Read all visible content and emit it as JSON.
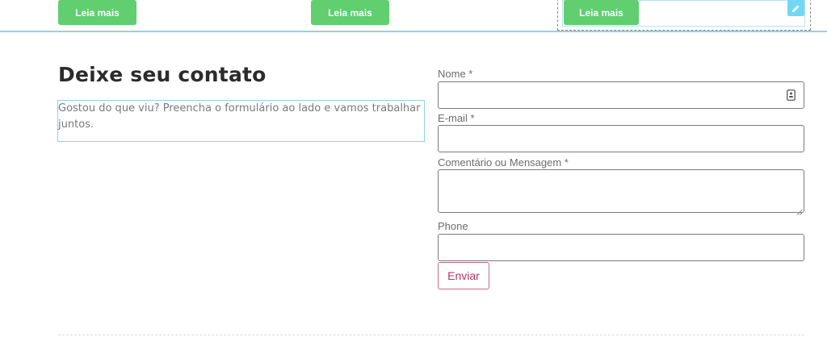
{
  "top_buttons": [
    {
      "label": "Leia mais"
    },
    {
      "label": "Leia mais"
    },
    {
      "label": "Leia mais"
    }
  ],
  "editor": {
    "edit_icon": "pencil-icon"
  },
  "contact": {
    "title": "Deixe seu contato",
    "description": "Gostou do que viu? Preencha o formulário ao lado e vamos trabalhar juntos."
  },
  "form": {
    "name_label": "Nome *",
    "email_label": "E-mail *",
    "message_label": "Comentário ou Mensagem *",
    "phone_label": "Phone",
    "name_value": "",
    "email_value": "",
    "message_value": "",
    "phone_value": "",
    "autofill_icon": "contact-card-icon",
    "submit_label": "Enviar"
  },
  "colors": {
    "button_green": "#61ce70",
    "editor_blue": "#71d7f7",
    "divider_blue": "#8fd3e6",
    "submit_accent": "#b0346a"
  }
}
